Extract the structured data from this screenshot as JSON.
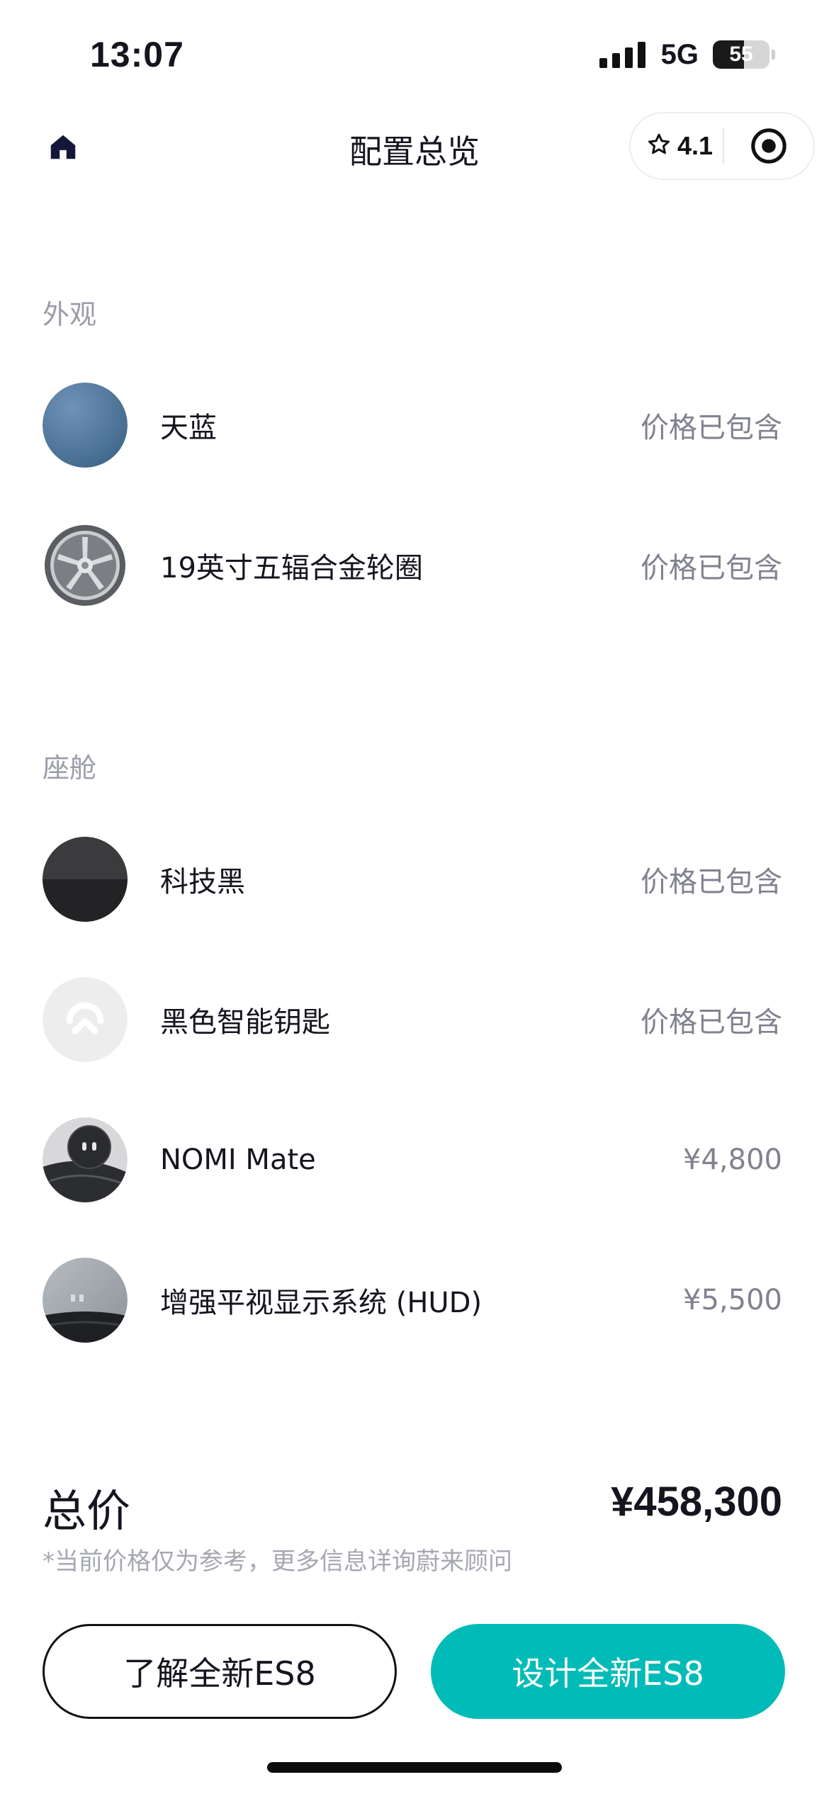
{
  "status_bar": {
    "time": "13:07",
    "network": "5G",
    "battery": "55",
    "battery_level": 0.55
  },
  "nav": {
    "title": "配置总览",
    "rating": "4.1",
    "icons": [
      "home-icon",
      "star-icon",
      "target-icon"
    ]
  },
  "colors": {
    "accent": "#00bbb7",
    "text_primary": "#15151f",
    "text_secondary": "#80828f",
    "section_title": "#9a9ca8"
  },
  "exterior": {
    "title": "外观",
    "items": [
      {
        "label": "天蓝",
        "price": "价格已包含"
      },
      {
        "label": "19英寸五辐合金轮圈",
        "price": "价格已包含"
      }
    ]
  },
  "cabin": {
    "title": "座舱",
    "items": [
      {
        "label": "科技黑",
        "price": "价格已包含"
      },
      {
        "label": "黑色智能钥匙",
        "price": "价格已包含"
      },
      {
        "label": "NOMI Mate",
        "price": "¥4,800"
      },
      {
        "label": "增强平视显示系统 (HUD)",
        "price": "¥5,500"
      }
    ]
  },
  "summary": {
    "total_label": "总价",
    "total_value": "¥458,300",
    "disclaimer": "*当前价格仅为参考，更多信息详询蔚来顾问"
  },
  "buttons": {
    "learn": "了解全新ES8",
    "design": "设计全新ES8"
  }
}
